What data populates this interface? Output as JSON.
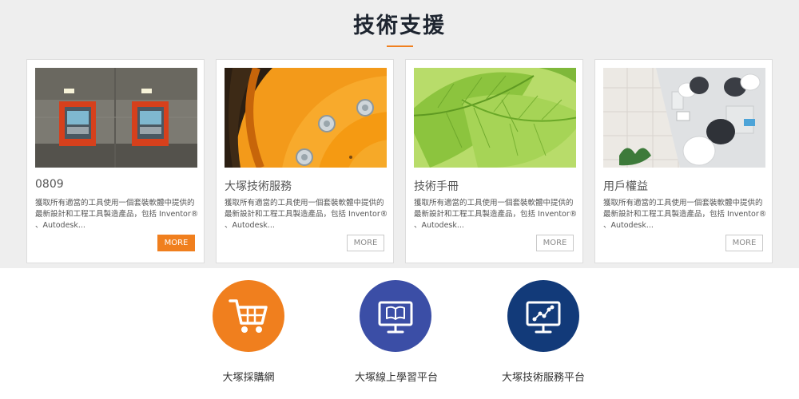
{
  "header": {
    "title": "技術支援"
  },
  "cards": [
    {
      "title": "0809",
      "desc": "獲取所有適當的工具使用一個套裝軟體中提供的最新設計和工程工具製造產品，包括 Inventor® 、Autodesk...",
      "more": "MORE",
      "more_active": true
    },
    {
      "title": "大塚技術服務",
      "desc": "獲取所有適當的工具使用一個套裝軟體中提供的最新設計和工程工具製造產品，包括 Inventor® 、Autodesk...",
      "more": "MORE",
      "more_active": false
    },
    {
      "title": "技術手冊",
      "desc": "獲取所有適當的工具使用一個套裝軟體中提供的最新設計和工程工具製造產品，包括 Inventor® 、Autodesk...",
      "more": "MORE",
      "more_active": false
    },
    {
      "title": "用戶權益",
      "desc": "獲取所有適當的工具使用一個套裝軟體中提供的最新設計和工程工具製造產品，包括 Inventor® 、Autodesk...",
      "more": "MORE",
      "more_active": false
    }
  ],
  "platforms": [
    {
      "label": "大塚採購網",
      "icon": "shopping-cart-icon",
      "color": "#f07f1e"
    },
    {
      "label": "大塚線上學習平台",
      "icon": "book-monitor-icon",
      "color": "#3b4ea6"
    },
    {
      "label": "大塚技術服務平台",
      "icon": "network-monitor-icon",
      "color": "#123a79"
    }
  ],
  "colors": {
    "accent": "#f07f1e",
    "section_bg": "#eeeeee"
  }
}
